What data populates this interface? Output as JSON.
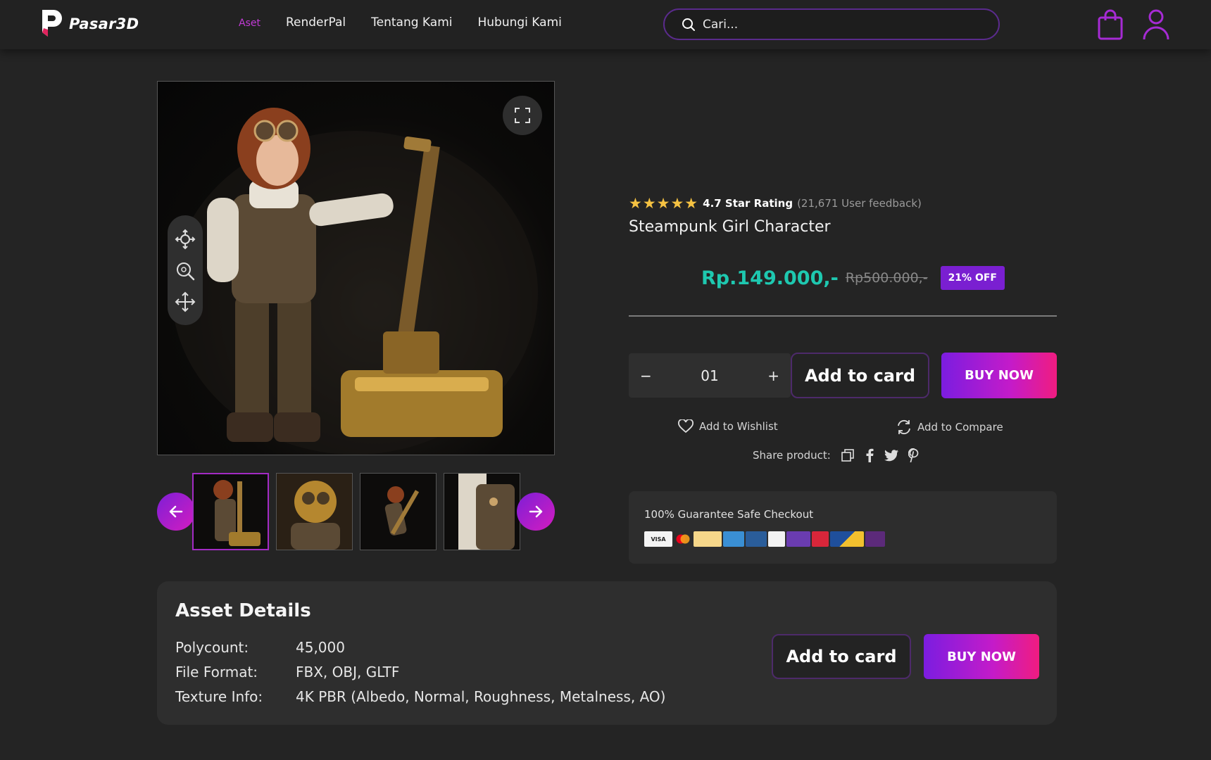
{
  "header": {
    "logo_text": "Pasar3D",
    "nav": [
      {
        "label": "Aset",
        "active": true
      },
      {
        "label": "RenderPal",
        "active": false
      },
      {
        "label": "Tentang Kami",
        "active": false
      },
      {
        "label": "Hubungi Kami",
        "active": false
      }
    ],
    "search_placeholder": "Cari..."
  },
  "product": {
    "rating_value": "4.7 Star Rating",
    "rating_count": "(21,671 User feedback)",
    "stars": "★★★★★",
    "title": "Steampunk Girl Character",
    "price": "Rp.149.000,-",
    "old_price": "Rp500.000,-",
    "discount_badge": "21% OFF",
    "quantity": "01",
    "qty_minus": "−",
    "qty_plus": "+",
    "add_to_cart_label": "Add to card",
    "buy_now_label": "BUY NOW",
    "wishlist_label": "Add to Wishlist",
    "compare_label": "Add to Compare",
    "share_label": "Share product:"
  },
  "guarantee": {
    "title": "100% Guarantee Safe Checkout",
    "payment_methods": [
      "VISA",
      "Mastercard",
      "PayPal",
      "Payment 4",
      "Payment 5",
      "Payment 6",
      "Payment 7",
      "Payment 8",
      "Payment 9",
      "Payment 10"
    ]
  },
  "details": {
    "title": "Asset Details",
    "specs": [
      {
        "key": "Polycount:",
        "value": "45,000"
      },
      {
        "key": "File Format:",
        "value": "FBX, OBJ, GLTF"
      },
      {
        "key": "Texture Info:",
        "value": "4K PBR (Albedo, Normal, Roughness, Metalness, AO)"
      }
    ],
    "add_to_cart_label": "Add to card",
    "buy_now_label": "BUY NOW"
  },
  "colors": {
    "accent_purple": "#7b1de0",
    "accent_pink": "#f01c80",
    "price_teal": "#1ec8b0",
    "star_yellow": "#f5c242"
  }
}
